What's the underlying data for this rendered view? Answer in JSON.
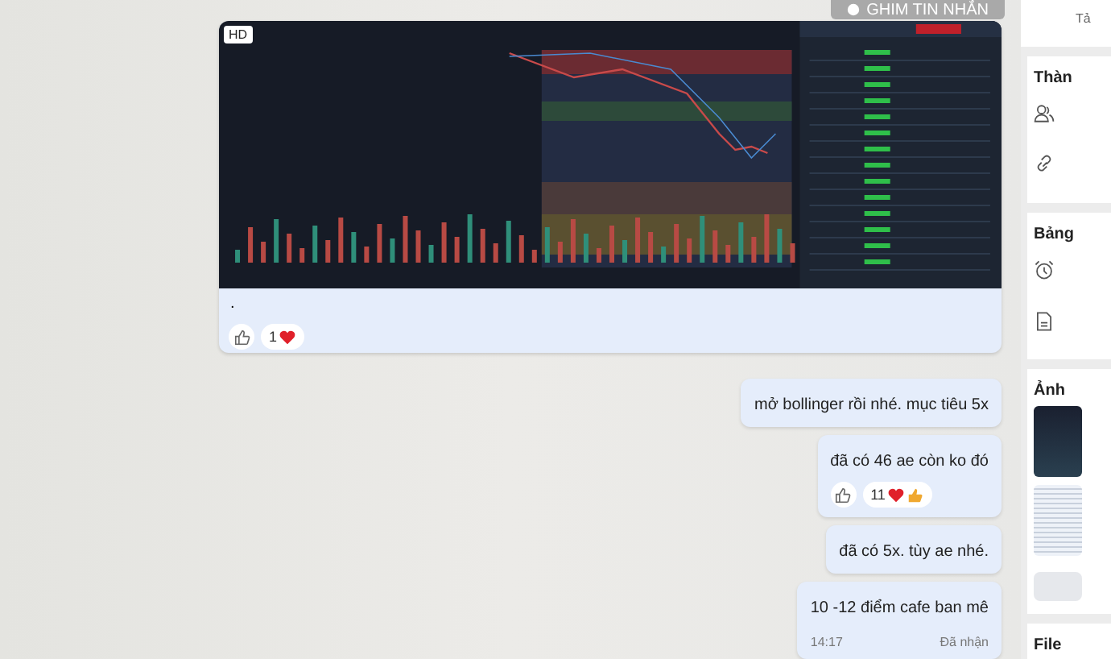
{
  "pin_button": {
    "label": "GHIM TIN NHẮN"
  },
  "image_message": {
    "badge": "HD",
    "caption": ".",
    "reaction": {
      "count": "1",
      "emojis": [
        {
          "kind": "heart"
        }
      ]
    }
  },
  "messages": [
    {
      "text": "mở bollinger rồi nhé. mục tiêu 5x"
    },
    {
      "text": "đã có 46 ae còn ko đó",
      "reaction": {
        "count": "11",
        "emojis": [
          {
            "kind": "heart"
          },
          {
            "kind": "thumbs"
          }
        ]
      }
    },
    {
      "text": "đã có 5x. tùy ae nhé."
    },
    {
      "text": "10 -12 điểm cafe ban mê",
      "time": "14:17",
      "status": "Đã nhận"
    }
  ],
  "side_panel": {
    "header": "Tả",
    "sections": [
      {
        "title": "Thàn",
        "items": [
          {
            "kind": "members"
          },
          {
            "kind": "link"
          }
        ]
      },
      {
        "title": "Bảng",
        "items": [
          {
            "kind": "alarm"
          },
          {
            "kind": "note"
          }
        ]
      },
      {
        "title": "Ảnh",
        "photos": [
          {
            "kind": "chart"
          },
          {
            "kind": "table"
          }
        ]
      },
      {
        "title": "File"
      }
    ]
  }
}
